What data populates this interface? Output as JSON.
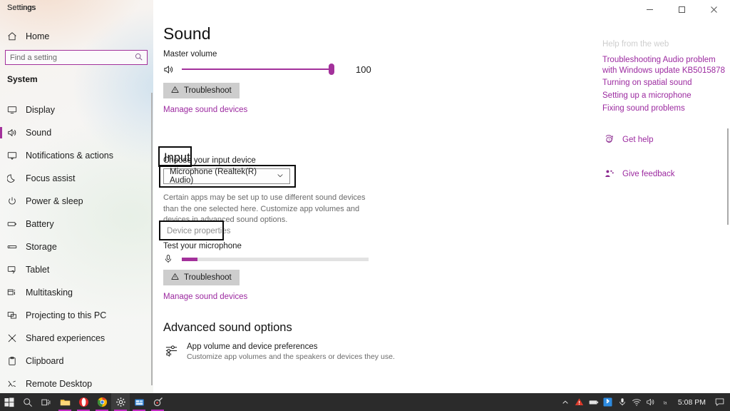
{
  "window": {
    "title": "Settings",
    "controls": {
      "minimize": "minimize",
      "maximize": "maximize",
      "close": "close"
    }
  },
  "sidebar": {
    "app_name": "Settings",
    "home_label": "Home",
    "search": {
      "placeholder": "Find a setting",
      "value": ""
    },
    "group_header": "System",
    "items": [
      {
        "label": "Display",
        "icon": "monitor-icon",
        "active": false
      },
      {
        "label": "Sound",
        "icon": "speaker-icon",
        "active": true
      },
      {
        "label": "Notifications & actions",
        "icon": "notification-icon",
        "active": false
      },
      {
        "label": "Focus assist",
        "icon": "moon-icon",
        "active": false
      },
      {
        "label": "Power & sleep",
        "icon": "power-icon",
        "active": false
      },
      {
        "label": "Battery",
        "icon": "battery-icon",
        "active": false
      },
      {
        "label": "Storage",
        "icon": "storage-icon",
        "active": false
      },
      {
        "label": "Tablet",
        "icon": "tablet-icon",
        "active": false
      },
      {
        "label": "Multitasking",
        "icon": "multitasking-icon",
        "active": false
      },
      {
        "label": "Projecting to this PC",
        "icon": "projecting-icon",
        "active": false
      },
      {
        "label": "Shared experiences",
        "icon": "shared-icon",
        "active": false
      },
      {
        "label": "Clipboard",
        "icon": "clipboard-icon",
        "active": false
      },
      {
        "label": "Remote Desktop",
        "icon": "remote-desktop-icon",
        "active": false
      }
    ]
  },
  "main": {
    "page_title": "Sound",
    "output": {
      "master_volume_label": "Master volume",
      "volume_value": "100",
      "volume_percent": 100,
      "troubleshoot_label": "Troubleshoot",
      "manage_devices_label": "Manage sound devices"
    },
    "input": {
      "heading": "Input",
      "choose_device_label": "Choose your input device",
      "selected_device": "Microphone (Realtek(R) Audio)",
      "help_text": "Certain apps may be set up to use different sound devices than the one selected here. Customize app volumes and devices in advanced sound options.",
      "device_properties_label": "Device properties",
      "test_mic_label": "Test your microphone",
      "mic_level_percent": 8,
      "troubleshoot_label": "Troubleshoot",
      "manage_devices_label": "Manage sound devices"
    },
    "advanced": {
      "heading": "Advanced sound options",
      "app_volume_title": "App volume and device preferences",
      "app_volume_desc": "Customize app volumes and the speakers or devices they use."
    }
  },
  "right_panel": {
    "help_header": "Help from the web",
    "links": [
      "Troubleshooting Audio problem with Windows update KB5015878",
      "Turning on spatial sound",
      "Setting up a microphone",
      "Fixing sound problems"
    ],
    "get_help_label": "Get help",
    "give_feedback_label": "Give feedback"
  },
  "taskbar": {
    "items": [
      {
        "name": "start-button",
        "running": false
      },
      {
        "name": "search-button",
        "running": false
      },
      {
        "name": "task-view-button",
        "running": false
      },
      {
        "name": "file-explorer",
        "running": true
      },
      {
        "name": "opera-browser",
        "running": true
      },
      {
        "name": "chrome-browser",
        "running": true
      },
      {
        "name": "settings-app",
        "running": true
      },
      {
        "name": "store-app",
        "running": true
      },
      {
        "name": "media-app",
        "running": true
      }
    ],
    "time": "5:08 PM"
  },
  "colors": {
    "accent": "#a3319b",
    "link": "#9c2aa0",
    "taskbar_bg": "#2b2b2b",
    "annotation": "#0a0a0a"
  }
}
